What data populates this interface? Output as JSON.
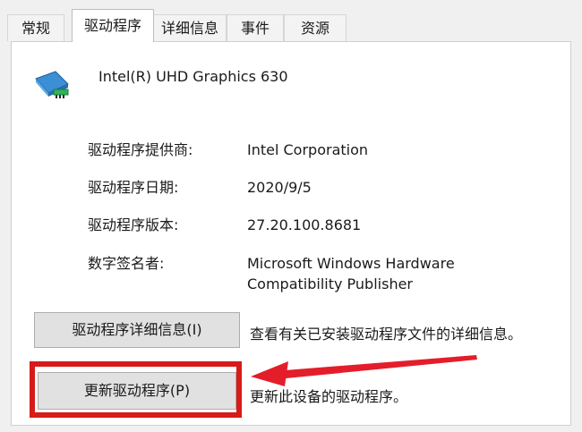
{
  "tabs": [
    {
      "label": "常规"
    },
    {
      "label": "驱动程序"
    },
    {
      "label": "详细信息"
    },
    {
      "label": "事件"
    },
    {
      "label": "资源"
    }
  ],
  "device": {
    "icon": "display-adapter-icon",
    "name": "Intel(R) UHD Graphics 630"
  },
  "properties": [
    {
      "label": "驱动程序提供商:",
      "value": "Intel Corporation"
    },
    {
      "label": "驱动程序日期:",
      "value": "2020/9/5"
    },
    {
      "label": "驱动程序版本:",
      "value": "27.20.100.8681"
    },
    {
      "label": "数字签名者:",
      "value_line1": "Microsoft Windows Hardware",
      "value_line2": "Compatibility Publisher"
    }
  ],
  "buttons": {
    "details_label": "驱动程序详细信息(I)",
    "details_desc": "查看有关已安装驱动程序文件的详细信息。",
    "update_label": "更新驱动程序(P)",
    "update_desc": "更新此设备的驱动程序。"
  },
  "annotation": {
    "highlight_color": "#d71a1a",
    "arrow_color": "#e31e2a"
  }
}
